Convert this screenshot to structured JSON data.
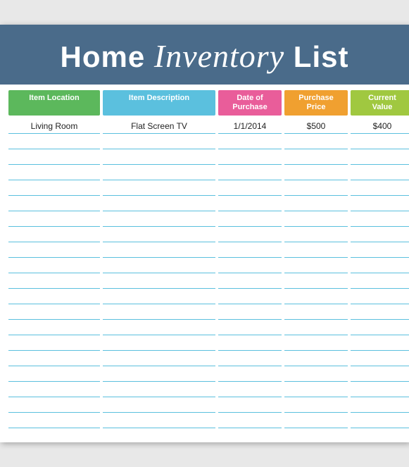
{
  "header": {
    "title_part1": "Home ",
    "title_cursive": "Inventory",
    "title_part2": " List"
  },
  "columns": [
    {
      "id": "location",
      "label": "Item Location",
      "color": "#5cb85c"
    },
    {
      "id": "description",
      "label": "Item Description",
      "color": "#5bc0de"
    },
    {
      "id": "date",
      "label": "Date of\nPurchase",
      "color": "#e95d9a"
    },
    {
      "id": "purchase_price",
      "label": "Purchase\nPrice",
      "color": "#f0a030"
    },
    {
      "id": "current_value",
      "label": "Current\nValue",
      "color": "#a0c840"
    }
  ],
  "rows": [
    {
      "location": "Living Room",
      "description": "Flat Screen TV",
      "date": "1/1/2014",
      "purchase_price": "$500",
      "current_value": "$400"
    },
    {
      "location": "",
      "description": "",
      "date": "",
      "purchase_price": "",
      "current_value": ""
    },
    {
      "location": "",
      "description": "",
      "date": "",
      "purchase_price": "",
      "current_value": ""
    },
    {
      "location": "",
      "description": "",
      "date": "",
      "purchase_price": "",
      "current_value": ""
    },
    {
      "location": "",
      "description": "",
      "date": "",
      "purchase_price": "",
      "current_value": ""
    },
    {
      "location": "",
      "description": "",
      "date": "",
      "purchase_price": "",
      "current_value": ""
    },
    {
      "location": "",
      "description": "",
      "date": "",
      "purchase_price": "",
      "current_value": ""
    },
    {
      "location": "",
      "description": "",
      "date": "",
      "purchase_price": "",
      "current_value": ""
    },
    {
      "location": "",
      "description": "",
      "date": "",
      "purchase_price": "",
      "current_value": ""
    },
    {
      "location": "",
      "description": "",
      "date": "",
      "purchase_price": "",
      "current_value": ""
    },
    {
      "location": "",
      "description": "",
      "date": "",
      "purchase_price": "",
      "current_value": ""
    },
    {
      "location": "",
      "description": "",
      "date": "",
      "purchase_price": "",
      "current_value": ""
    },
    {
      "location": "",
      "description": "",
      "date": "",
      "purchase_price": "",
      "current_value": ""
    },
    {
      "location": "",
      "description": "",
      "date": "",
      "purchase_price": "",
      "current_value": ""
    },
    {
      "location": "",
      "description": "",
      "date": "",
      "purchase_price": "",
      "current_value": ""
    },
    {
      "location": "",
      "description": "",
      "date": "",
      "purchase_price": "",
      "current_value": ""
    },
    {
      "location": "",
      "description": "",
      "date": "",
      "purchase_price": "",
      "current_value": ""
    },
    {
      "location": "",
      "description": "",
      "date": "",
      "purchase_price": "",
      "current_value": ""
    },
    {
      "location": "",
      "description": "",
      "date": "",
      "purchase_price": "",
      "current_value": ""
    },
    {
      "location": "",
      "description": "",
      "date": "",
      "purchase_price": "",
      "current_value": ""
    }
  ]
}
